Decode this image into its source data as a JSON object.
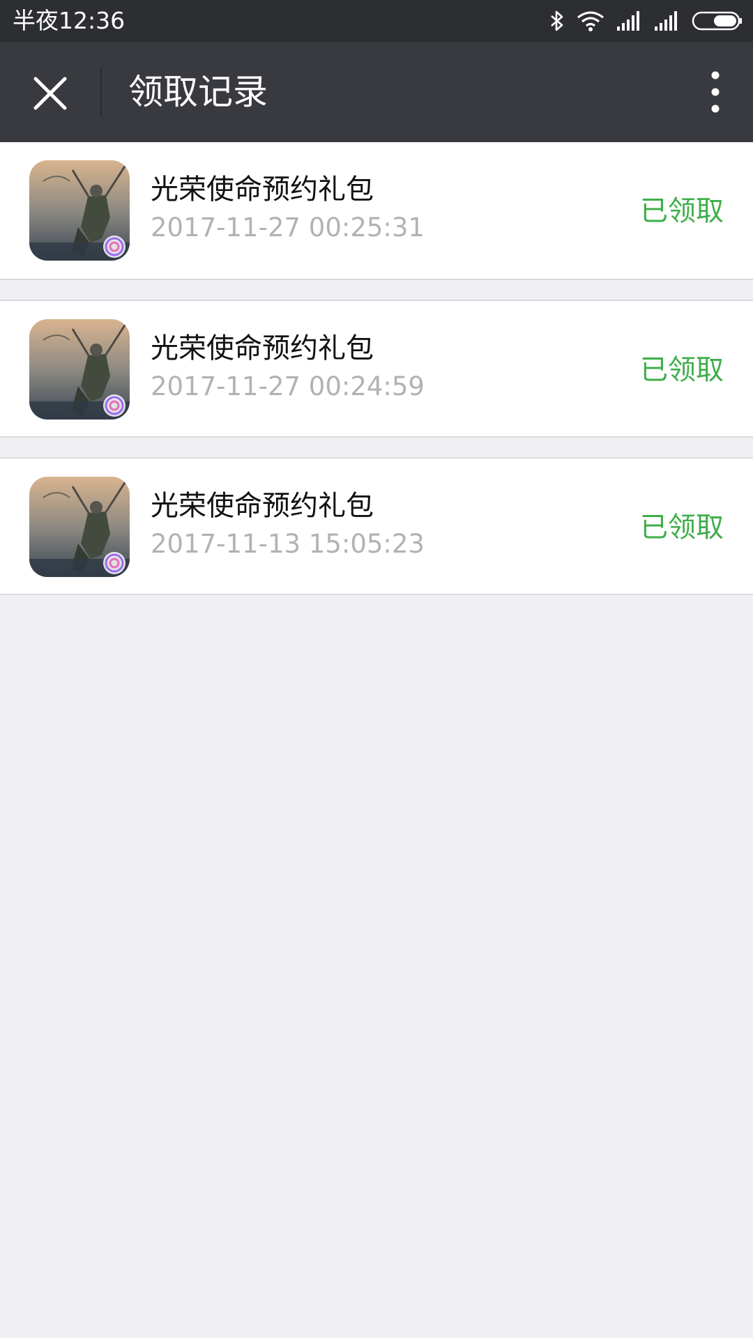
{
  "status_bar": {
    "time": "半夜12:36",
    "icons": [
      "bluetooth-icon",
      "wifi-icon",
      "signal-icon",
      "signal-icon",
      "battery-icon"
    ]
  },
  "nav": {
    "title": "领取记录",
    "close_icon": "close-icon",
    "more_icon": "more-vertical-icon"
  },
  "records": [
    {
      "name": "光荣使命预约礼包",
      "time": "2017-11-27 00:25:31",
      "status": "已领取"
    },
    {
      "name": "光荣使命预约礼包",
      "time": "2017-11-27 00:24:59",
      "status": "已领取"
    },
    {
      "name": "光荣使命预约礼包",
      "time": "2017-11-13 15:05:23",
      "status": "已领取"
    }
  ],
  "colors": {
    "nav_background": "#393a3f",
    "status_background": "#2d2e32",
    "page_background": "#efeff4",
    "status_text": "#3fae4b",
    "time_text": "#b2b2b2"
  }
}
